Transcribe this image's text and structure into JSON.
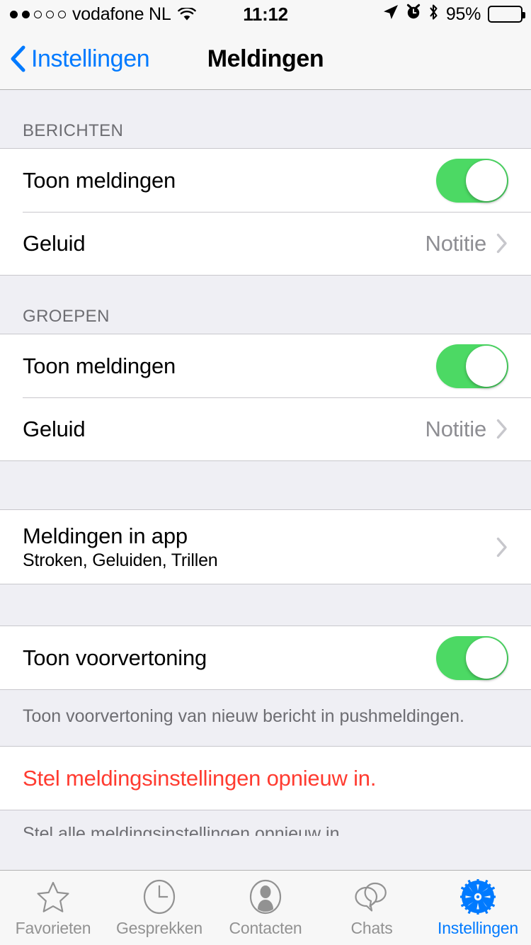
{
  "status_bar": {
    "signal_dots_filled": 2,
    "signal_dots_total": 5,
    "carrier": "vodafone NL",
    "wifi_icon": "wifi-icon",
    "time": "11:12",
    "location_icon": "location-arrow-icon",
    "alarm_icon": "alarm-clock-icon",
    "bluetooth_icon": "bluetooth-icon",
    "battery_percent": "95%",
    "battery_icon": "battery-icon"
  },
  "nav_bar": {
    "back_label": "Instellingen",
    "back_icon": "chevron-left-icon",
    "title": "Meldingen"
  },
  "sections": {
    "berichten": {
      "header": "BERICHTEN",
      "show_notifications_label": "Toon meldingen",
      "show_notifications_on": true,
      "sound_label": "Geluid",
      "sound_value": "Notitie"
    },
    "groepen": {
      "header": "GROEPEN",
      "show_notifications_label": "Toon meldingen",
      "show_notifications_on": true,
      "sound_label": "Geluid",
      "sound_value": "Notitie"
    },
    "in_app": {
      "title": "Meldingen in app",
      "subtitle": "Stroken, Geluiden, Trillen"
    },
    "preview": {
      "label": "Toon voorvertoning",
      "on": true,
      "footer": "Toon voorvertoning van nieuw bericht in pushmeldingen."
    },
    "reset": {
      "label": "Stel meldingsinstellingen opnieuw in.",
      "footer": "Stel alle meldingsinstellingen opnieuw in."
    }
  },
  "tab_bar": {
    "tabs": [
      {
        "label": "Favorieten",
        "icon": "star-icon",
        "active": false
      },
      {
        "label": "Gesprekken",
        "icon": "clock-icon",
        "active": false
      },
      {
        "label": "Contacten",
        "icon": "person-icon",
        "active": false
      },
      {
        "label": "Chats",
        "icon": "chat-bubbles-icon",
        "active": false
      },
      {
        "label": "Instellingen",
        "icon": "gear-icon",
        "active": true
      }
    ]
  },
  "colors": {
    "accent_blue": "#007AFF",
    "toggle_green": "#4CD964",
    "destructive_red": "#FF3B30",
    "group_bg": "#EFEFF4",
    "separator": "#C8C7CC",
    "secondary_text": "#8E8E93"
  }
}
